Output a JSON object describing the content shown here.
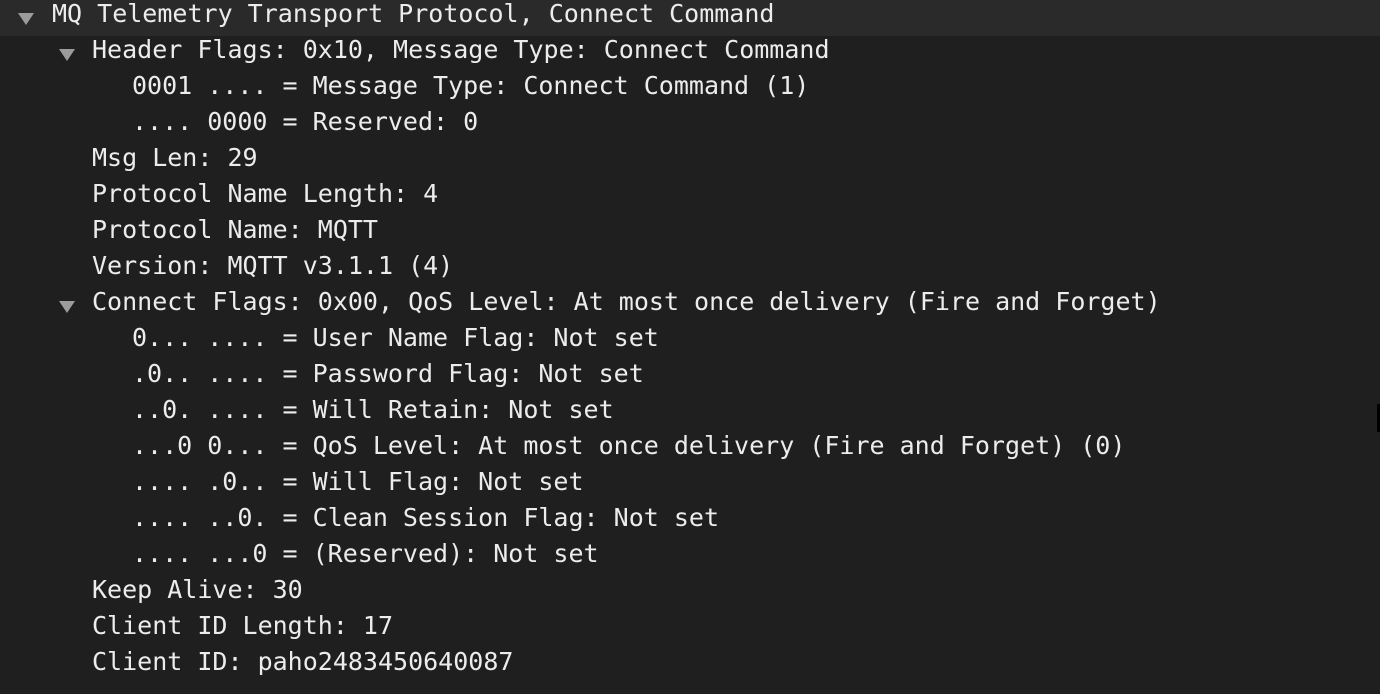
{
  "tree": {
    "root": "MQ Telemetry Transport Protocol, Connect Command",
    "header_flags": {
      "label": "Header Flags: 0x10, Message Type: Connect Command",
      "message_type": "0001 .... = Message Type: Connect Command (1)",
      "reserved": ".... 0000 = Reserved: 0"
    },
    "msg_len": "Msg Len: 29",
    "protocol_name_length": "Protocol Name Length: 4",
    "protocol_name": "Protocol Name: MQTT",
    "version": "Version: MQTT v3.1.1 (4)",
    "connect_flags": {
      "label": "Connect Flags: 0x00, QoS Level: At most once delivery (Fire and Forget)",
      "user_name_flag": "0... .... = User Name Flag: Not set",
      "password_flag": ".0.. .... = Password Flag: Not set",
      "will_retain": "..0. .... = Will Retain: Not set",
      "qos_level": "...0 0... = QoS Level: At most once delivery (Fire and Forget) (0)",
      "will_flag": ".... .0.. = Will Flag: Not set",
      "clean_session_flag": ".... ..0. = Clean Session Flag: Not set",
      "reserved": ".... ...0 = (Reserved): Not set"
    },
    "keep_alive": "Keep Alive: 30",
    "client_id_length": "Client ID Length: 17",
    "client_id": "Client ID: paho2483450640087"
  },
  "icons": {
    "expander": "triangle-down-icon"
  },
  "colors": {
    "background": "#1f1f1f",
    "selected_row": "#2a2a2a",
    "text": "#ececec",
    "expander": "#9c9c9c"
  }
}
